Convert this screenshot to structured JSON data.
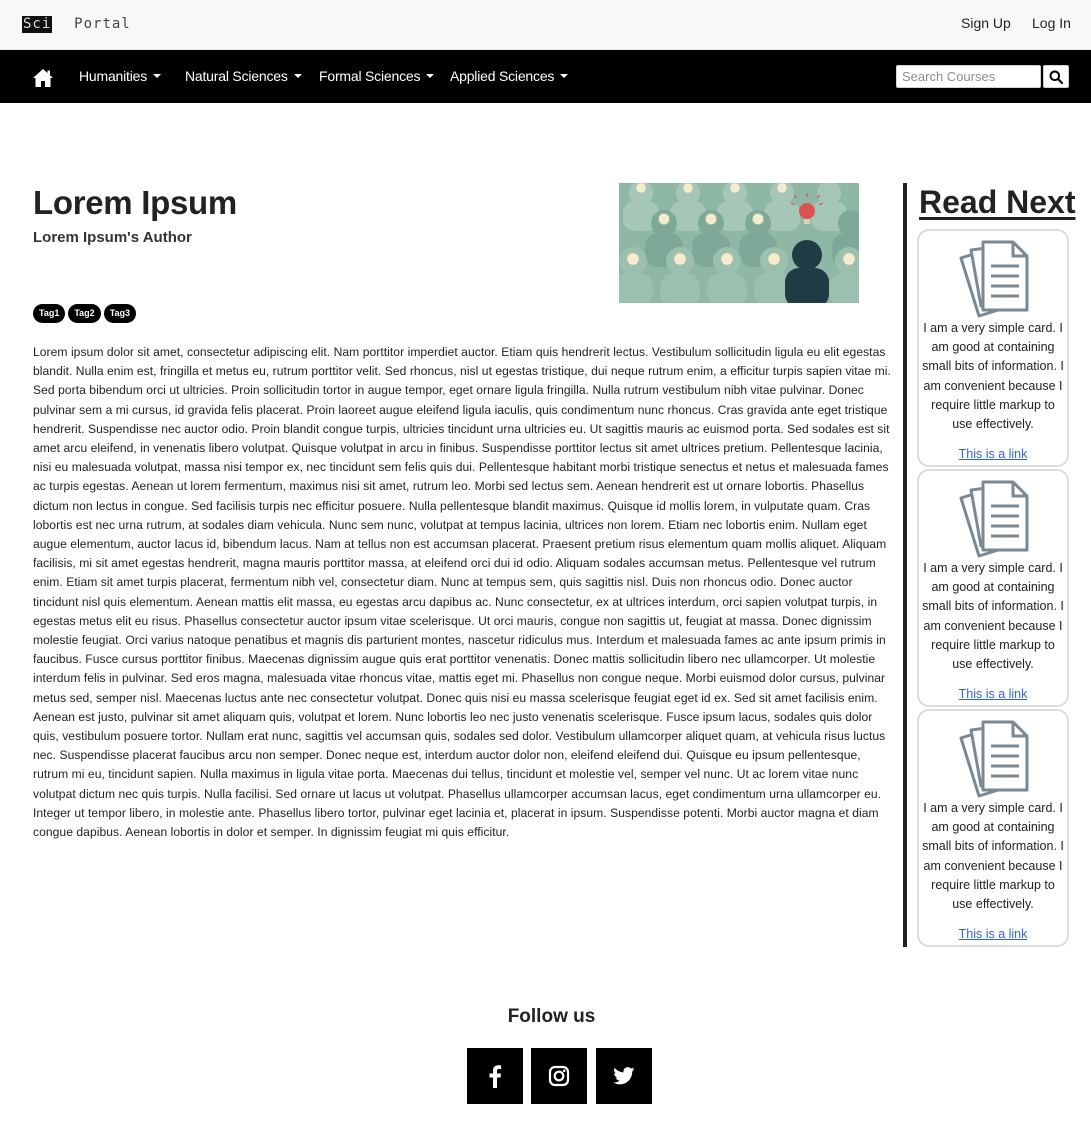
{
  "brand": {
    "logo_text_part1": "Sci",
    "logo_text_part2": "Portal"
  },
  "auth": {
    "signup": "Sign Up",
    "login": "Log In"
  },
  "nav": {
    "home_icon": "home-icon",
    "items": [
      {
        "label": "Humanities"
      },
      {
        "label": "Natural Sciences"
      },
      {
        "label": "Formal Sciences"
      },
      {
        "label": "Applied Sciences"
      }
    ],
    "search_placeholder": "Search Courses",
    "search_icon": "search-icon"
  },
  "article": {
    "title": "Lorem Ipsum",
    "author": "Lorem Ipsum's Author",
    "tags": [
      "Tag1",
      "Tag2",
      "Tag3"
    ],
    "body": "Lorem ipsum dolor sit amet, consectetur adipiscing elit. Nam porttitor imperdiet auctor. Etiam quis hendrerit lectus. Vestibulum sollicitudin ligula eu elit egestas blandit. Nulla enim est, fringilla et metus eu, rutrum porttitor velit. Sed rhoncus, nisl ut egestas tristique, dui neque rutrum enim, a efficitur turpis sapien vitae mi. Sed porta bibendum orci ut ultricies. Proin sollicitudin tortor in augue tempor, eget ornare ligula fringilla. Nulla rutrum vestibulum nibh vitae pulvinar. Donec pulvinar sem a mi cursus, id gravida felis placerat. Proin laoreet augue eleifend ligula iaculis, quis condimentum nunc rhoncus. Cras gravida ante eget tristique hendrerit. Suspendisse nec auctor odio. Proin blandit congue turpis, ultricies tincidunt urna ultricies eu. Ut sagittis mauris ac euismod porta. Sed sodales est sit amet arcu eleifend, in venenatis libero volutpat. Quisque volutpat in arcu in finibus. Suspendisse porttitor lectus sit amet ultrices pretium. Pellentesque lacinia, nisi eu malesuada volutpat, massa nisi tempor ex, nec tincidunt sem felis quis dui. Pellentesque habitant morbi tristique senectus et netus et malesuada fames ac turpis egestas. Aenean ut lorem fermentum, maximus nisi sit amet, rutrum leo. Morbi sed lectus sem. Aenean hendrerit est ut ornare lobortis. Phasellus dictum non lectus in congue. Sed facilisis turpis nec efficitur posuere. Nulla pellentesque blandit maximus. Quisque id mollis lorem, in vulputate quam. Cras lobortis est nec urna rutrum, at sodales diam vehicula. Nunc sem nunc, volutpat at tempus lacinia, ultrices non lorem. Etiam nec lobortis enim. Nullam eget augue elementum, auctor lacus id, bibendum lacus. Nam at tellus non est accumsan placerat. Praesent pretium risus elementum quam mollis aliquet. Aliquam facilisis, mi sit amet egestas hendrerit, magna mauris porttitor massa, at eleifend orci dui id odio. Aliquam sodales accumsan metus. Pellentesque vel rutrum enim. Etiam sit amet turpis placerat, fermentum nibh vel, consectetur diam. Nunc at tempus sem, quis sagittis nisl. Duis non rhoncus odio. Donec auctor tincidunt nisl quis elementum. Aenean mattis elit massa, eu egestas arcu dapibus ac. Nunc consectetur, ex at ultrices interdum, orci sapien volutpat turpis, in egestas metus elit eu risus. Phasellus consectetur auctor ipsum vitae scelerisque. Ut orci mauris, congue non sagittis ut, feugiat at massa. Donec dignissim molestie feugiat. Orci varius natoque penatibus et magnis dis parturient montes, nascetur ridiculus mus. Interdum et malesuada fames ac ante ipsum primis in faucibus. Fusce cursus porttitor finibus. Maecenas dignissim augue quis erat porttitor venenatis. Donec mattis sollicitudin libero nec ullamcorper. Ut molestie interdum felis in pulvinar. Sed eros magna, malesuada vitae rhoncus vitae, mattis eget mi. Phasellus non congue neque. Morbi euismod dolor cursus, pulvinar metus sed, semper nisl. Maecenas luctus ante nec consectetur volutpat. Donec quis nisi eu massa scelerisque feugiat eget id ex. Sed sit amet facilisis enim. Aenean est justo, pulvinar sit amet aliquam quis, volutpat et lorem. Nunc lobortis leo nec justo venenatis scelerisque. Fusce ipsum lacus, sodales quis dolor quis, vestibulum posuere tortor. Nullam erat nunc, sagittis vel accumsan quis, sodales sed dolor. Vestibulum ullamcorper aliquet quam, at vehicula risus luctus nec. Suspendisse placerat faucibus arcu non semper. Donec neque est, interdum auctor dolor non, eleifend eleifend dui. Quisque eu ipsum pellentesque, rutrum mi eu, tincidunt sapien. Nulla maximus in ligula vitae porta. Maecenas dui tellus, tincidunt et molestie vel, semper vel nunc. Ut ac lorem vitae nunc volutpat dictum nec quis turpis. Nulla facilisi. Sed ornare ut lacus ut volutpat. Phasellus ullamcorper accumsan lacus, eget condimentum urna ullamcorper eu. Integer ut tempor libero, in molestie ante. Phasellus libero tortor, pulvinar eget lacinia et, placerat in ipsum. Suspendisse potenti. Morbi auctor magna et diam congue dapibus. Aenean lobortis in dolor et semper. In dignissim feugiat mi quis efficitur."
  },
  "sidebar": {
    "title": "Read Next",
    "cards": [
      {
        "icon": "document-icon",
        "text": "I am a very simple card. I am good at containing small bits of information. I am convenient because I require little markup to use effectively.",
        "link": "This is a link"
      },
      {
        "icon": "document-icon",
        "text": "I am a very simple card. I am good at containing small bits of information. I am convenient because I require little markup to use effectively.",
        "link": "This is a link"
      },
      {
        "icon": "document-icon",
        "text": "I am a very simple card. I am good at containing small bits of information. I am convenient because I require little markup to use effectively.",
        "link": "This is a link"
      }
    ]
  },
  "footer": {
    "follow_label": "Follow us",
    "social": [
      {
        "icon": "facebook-icon"
      },
      {
        "icon": "instagram-icon"
      },
      {
        "icon": "twitter-icon"
      }
    ]
  },
  "colors": {
    "nav_bg": "#000000",
    "topbar_bg": "#f7f8fa",
    "link": "#3366cc",
    "hero_bg": "#8db6a5"
  }
}
